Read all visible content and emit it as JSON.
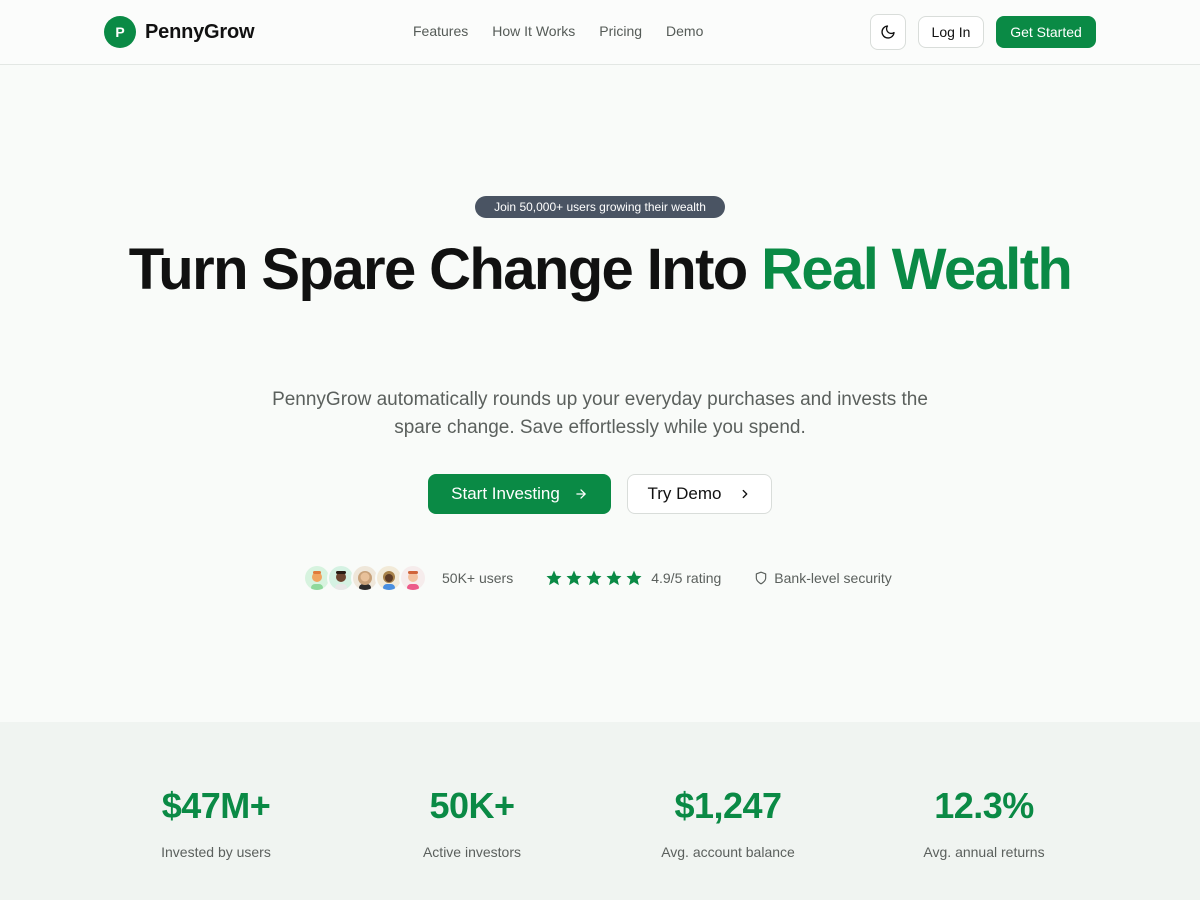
{
  "header": {
    "brand_initial": "P",
    "brand_name": "PennyGrow",
    "nav": [
      "Features",
      "How It Works",
      "Pricing",
      "Demo"
    ],
    "theme_icon": "moon-icon",
    "login_label": "Log In",
    "cta_label": "Get Started"
  },
  "hero": {
    "badge": "Join 50,000+ users growing their wealth",
    "title_main": "Turn Spare Change Into ",
    "title_accent": "Real Wealth",
    "subtitle": "PennyGrow automatically rounds up your everyday purchases and invests the spare change. Save effortlessly while you spend.",
    "primary_cta": "Start Investing",
    "secondary_cta": "Try Demo"
  },
  "proof": {
    "users_text": "50K+ users",
    "rating_text": "4.9/5 rating",
    "rating_stars": 5,
    "security_text": "Bank-level security"
  },
  "stats": [
    {
      "value": "$47M+",
      "label": "Invested by users"
    },
    {
      "value": "50K+",
      "label": "Active investors"
    },
    {
      "value": "$1,247",
      "label": "Avg. account balance"
    },
    {
      "value": "12.3%",
      "label": "Avg. annual returns"
    }
  ],
  "colors": {
    "brand_green": "#0a8a45",
    "badge_bg": "#4a5463",
    "page_bg": "#f9fbf9",
    "stats_bg": "#f0f4f1"
  }
}
